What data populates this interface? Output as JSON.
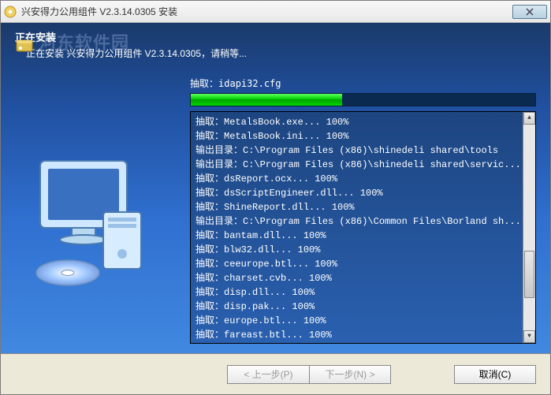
{
  "window": {
    "title": "兴安得力公用组件 V2.3.14.0305 安装"
  },
  "watermark": "河东软件园",
  "header": {
    "title": "正在安装",
    "subtitle": "正在安装 兴安得力公用组件 V2.3.14.0305，请稍等..."
  },
  "progress": {
    "label_prefix": "抽取：",
    "current_file": "idapi32.cfg",
    "percent": 44
  },
  "log": [
    "抽取：MetalsBook.exe... 100%",
    "抽取：MetalsBook.ini... 100%",
    "输出目录：C:\\Program Files (x86)\\shinedeli shared\\tools",
    "输出目录：C:\\Program Files (x86)\\shinedeli shared\\servic...",
    "抽取：dsReport.ocx... 100%",
    "抽取：dsScriptEngineer.dll... 100%",
    "抽取：ShineReport.dll... 100%",
    "输出目录：C:\\Program Files (x86)\\Common Files\\Borland sh...",
    "抽取：bantam.dll... 100%",
    "抽取：blw32.dll... 100%",
    "抽取：ceeurope.btl... 100%",
    "抽取：charset.cvb... 100%",
    "抽取：disp.dll... 100%",
    "抽取：disp.pak... 100%",
    "抽取：europe.btl... 100%",
    "抽取：fareast.btl... 100%"
  ],
  "buttons": {
    "back": "< 上一步(P)",
    "next": "下一步(N) >",
    "cancel": "取消(C)"
  }
}
